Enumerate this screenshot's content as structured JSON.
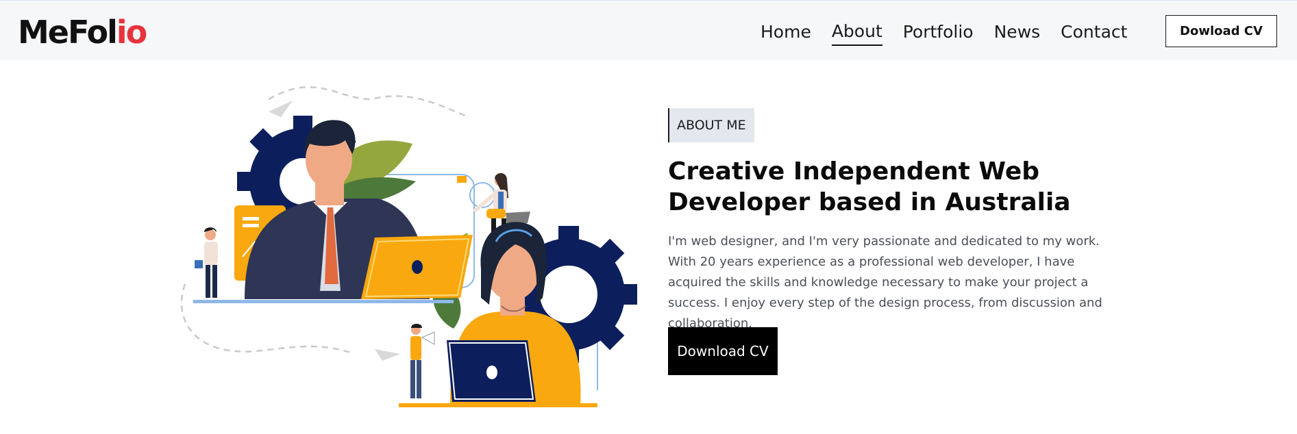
{
  "brand": {
    "logo_part1": "MeFol",
    "logo_part2": "io"
  },
  "nav": {
    "items": [
      "Home",
      "About",
      "Portfolio",
      "News",
      "Contact"
    ],
    "active": "About"
  },
  "header": {
    "cv_button": "Dowload CV"
  },
  "hero": {
    "eyebrow": "ABOUT ME",
    "headline": "Creative Independent Web Developer based in Australia",
    "description": "I'm web designer, and I'm very passionate and dedicated to my work. With 20 years experience as a professional web developer, I have acquired the skills and knowledge necessary to make your project a success. I enjoy every step of the design process, from discussion and collaboration.",
    "cta": "Download CV"
  },
  "colors": {
    "accent": "#e8323c",
    "navy": "#0c1f5c",
    "yellow": "#f9a80f",
    "header_bg": "#f6f7f9"
  }
}
